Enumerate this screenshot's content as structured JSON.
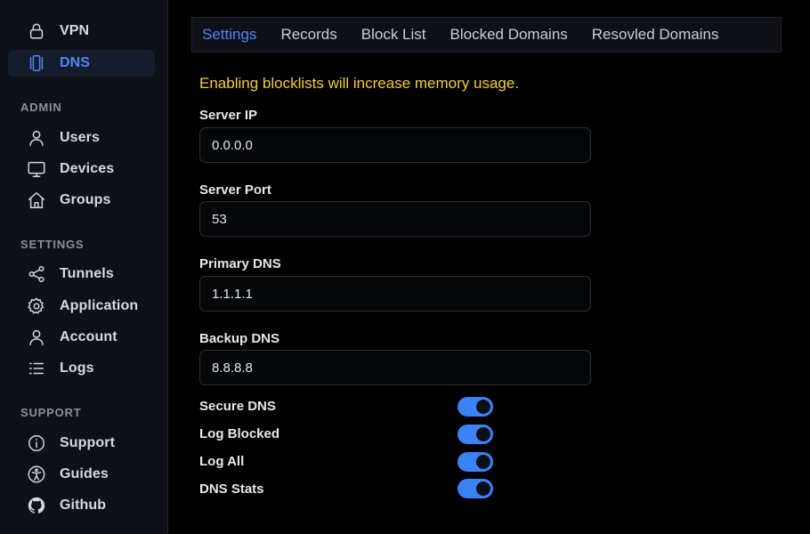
{
  "sidebar": {
    "items_top": [
      {
        "label": "VPN",
        "icon": "lock-icon",
        "active": false
      },
      {
        "label": "DNS",
        "icon": "dns-icon",
        "active": true
      }
    ],
    "admin": {
      "title": "ADMIN",
      "items": [
        {
          "label": "Users",
          "icon": "user-icon"
        },
        {
          "label": "Devices",
          "icon": "monitor-icon"
        },
        {
          "label": "Groups",
          "icon": "home-icon"
        }
      ]
    },
    "settings": {
      "title": "SETTINGS",
      "items": [
        {
          "label": "Tunnels",
          "icon": "share-icon"
        },
        {
          "label": "Application",
          "icon": "gear-icon"
        },
        {
          "label": "Account",
          "icon": "user-icon"
        },
        {
          "label": "Logs",
          "icon": "list-icon"
        }
      ]
    },
    "support": {
      "title": "SUPPORT",
      "items": [
        {
          "label": "Support",
          "icon": "info-icon"
        },
        {
          "label": "Guides",
          "icon": "accessibility-icon"
        },
        {
          "label": "Github",
          "icon": "github-icon"
        }
      ]
    }
  },
  "tabs": [
    {
      "label": "Settings",
      "active": true
    },
    {
      "label": "Records",
      "active": false
    },
    {
      "label": "Block List",
      "active": false
    },
    {
      "label": "Blocked Domains",
      "active": false
    },
    {
      "label": "Resovled Domains",
      "active": false
    }
  ],
  "form": {
    "warning": "Enabling blocklists will increase memory usage.",
    "fields": [
      {
        "label": "Server IP",
        "value": "0.0.0.0"
      },
      {
        "label": "Server Port",
        "value": "53"
      },
      {
        "label": "Primary DNS",
        "value": "1.1.1.1"
      },
      {
        "label": "Backup DNS",
        "value": "8.8.8.8"
      }
    ],
    "toggles": [
      {
        "label": "Secure DNS",
        "on": true
      },
      {
        "label": "Log Blocked",
        "on": true
      },
      {
        "label": "Log All",
        "on": true
      },
      {
        "label": "DNS Stats",
        "on": true
      }
    ]
  },
  "colors": {
    "accent": "#4f86f7",
    "warning": "#f5cd36",
    "toggle_on": "#3b82f6",
    "sidebar_bg": "#0d1117"
  }
}
